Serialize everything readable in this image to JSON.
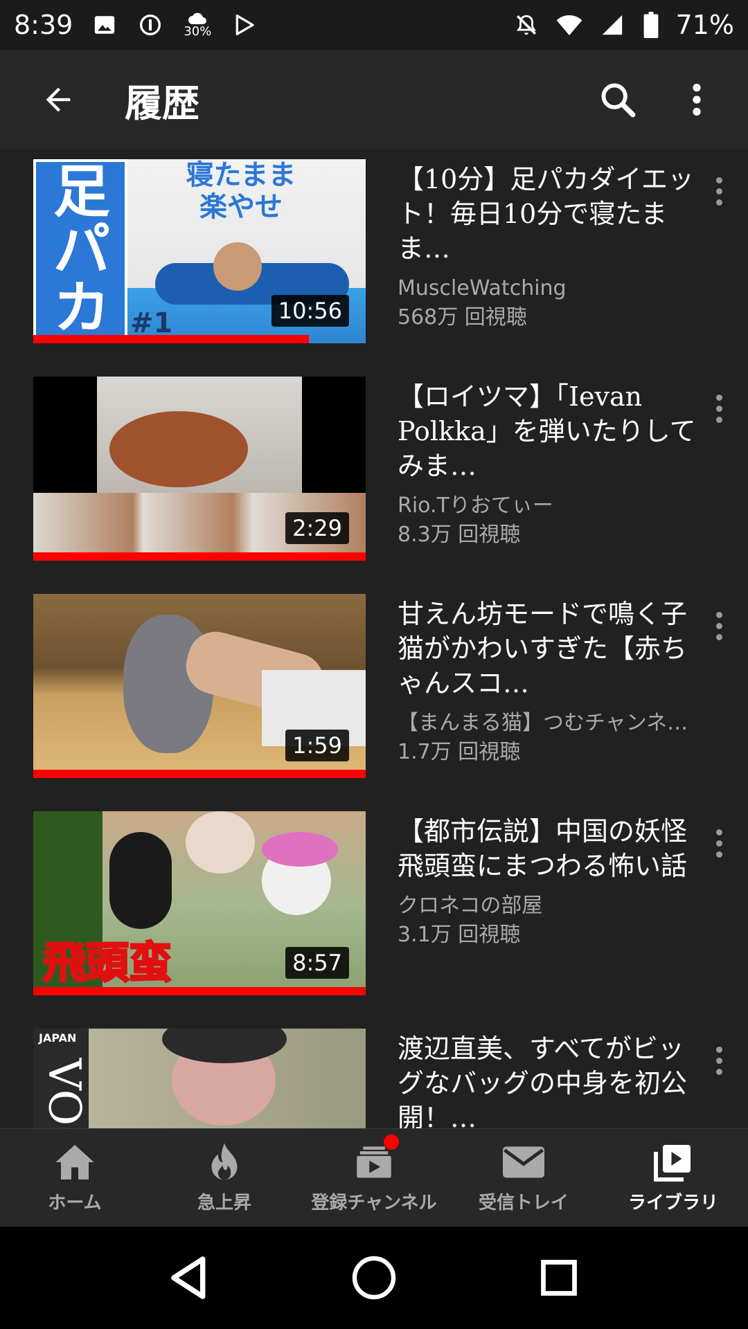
{
  "statusbar": {
    "time": "8:39",
    "weather_badge": "30%",
    "battery": "71%"
  },
  "appbar": {
    "title": "履歴"
  },
  "videos": [
    {
      "title": "【10分】足パカダイエット！毎日10分で寝たまま…",
      "channel": "MuscleWatching",
      "views": "568万 回視聴",
      "duration": "10:56",
      "progress": 0.83,
      "thumb_text_1": "足パカ",
      "thumb_text_2": "寝たまま 楽やせ",
      "thumb_text_3": "#1"
    },
    {
      "title": "【ロイツマ】「Ievan Polkka」を弾いたりしてみま…",
      "channel": "Rio.Tりおてぃー",
      "views": "8.3万 回視聴",
      "duration": "2:29",
      "progress": 1.0
    },
    {
      "title": "甘えん坊モードで鳴く子猫がかわいすぎた【赤ちゃんスコ…",
      "channel": "【まんまる猫】つむチャンネ…",
      "views": "1.7万 回視聴",
      "duration": "1:59",
      "progress": 1.0
    },
    {
      "title": "【都市伝説】中国の妖怪　飛頭蛮にまつわる怖い話",
      "channel": "クロネコの部屋",
      "views": "3.1万 回視聴",
      "duration": "8:57",
      "progress": 1.0,
      "thumb_text_1": "飛頭蛮"
    },
    {
      "title": "渡辺直美、すべてがビッグなバッグの中身を初公開！…",
      "channel": "",
      "views": "",
      "duration": "",
      "progress": 0,
      "thumb_text_1": "JAPAN",
      "thumb_text_2": "VOG"
    }
  ],
  "bottomnav": {
    "tabs": [
      {
        "label": "ホーム",
        "icon": "home-icon"
      },
      {
        "label": "急上昇",
        "icon": "flame-icon"
      },
      {
        "label": "登録チャンネル",
        "icon": "subscriptions-icon"
      },
      {
        "label": "受信トレイ",
        "icon": "mail-icon"
      },
      {
        "label": "ライブラリ",
        "icon": "library-icon"
      }
    ],
    "active_index": 4
  },
  "colors": {
    "progress": "#ff0000",
    "appbar": "#282828",
    "list_bg": "#212121",
    "secondary_text": "#aaaaaa"
  }
}
